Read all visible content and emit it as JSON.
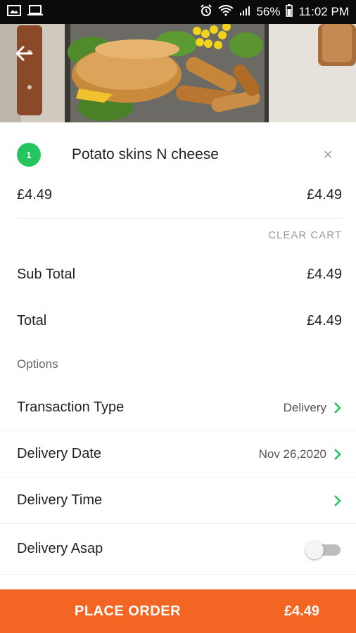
{
  "status_bar": {
    "battery": "56%",
    "time": "11:02 PM"
  },
  "cart": {
    "item": {
      "qty": "1",
      "name": "Potato skins N cheese",
      "unit_price": "£4.49",
      "line_total": "£4.49",
      "remove_glyph": "×"
    },
    "clear_label": "CLEAR CART",
    "subtotal_label": "Sub Total",
    "subtotal_value": "£4.49",
    "total_label": "Total",
    "total_value": "£4.49"
  },
  "options": {
    "heading": "Options",
    "transaction_type": {
      "label": "Transaction Type",
      "value": "Delivery"
    },
    "delivery_date": {
      "label": "Delivery Date",
      "value": "Nov 26,2020"
    },
    "delivery_time": {
      "label": "Delivery Time",
      "value": ""
    },
    "delivery_asap": {
      "label": "Delivery Asap",
      "enabled": false
    }
  },
  "order_bar": {
    "label": "PLACE ORDER",
    "total": "£4.49"
  },
  "colors": {
    "accent_green": "#22c55e",
    "order_orange": "#f26522"
  }
}
